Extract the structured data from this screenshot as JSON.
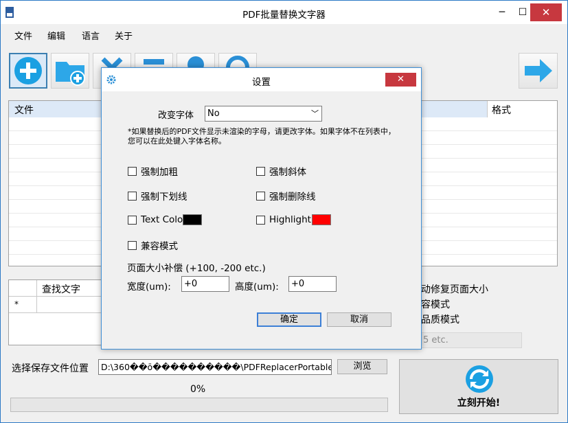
{
  "window": {
    "title": "PDF批量替换文字器",
    "minimize": "─",
    "maximize": "☐",
    "close": "✕"
  },
  "menu": [
    "文件",
    "编辑",
    "语言",
    "关于"
  ],
  "toolbar": {
    "buttons": [
      "add-file-icon",
      "add-folder-icon",
      "delete-icon",
      "clear-icon",
      "settings-icon",
      "help-icon"
    ],
    "next_icon": "arrow-right-icon"
  },
  "file_grid": {
    "col_file": "文件",
    "col_format": "格式"
  },
  "find_grid": {
    "col_find": "查找文字",
    "new_row_marker": "*"
  },
  "background_options": {
    "opt1": "动修复页面大小",
    "opt2": "容模式",
    "opt3": "品质模式",
    "input_partial": "5 etc."
  },
  "save": {
    "label": "选择保存文件位置",
    "path": "D:\\360��ō����������\\PDFReplacerPortable\\P",
    "browse": "浏览"
  },
  "progress": {
    "text": "0%",
    "value": 0
  },
  "start": {
    "label": "立刻开始!"
  },
  "colors": {
    "text_color": "#000000",
    "highlight": "#ff0000",
    "accent": "#3c7fd6"
  },
  "dialog": {
    "title": "设置",
    "close": "✕",
    "font_label": "改变字体",
    "font_value": "No",
    "note": "*如果替换后的PDF文件显示未渲染的字母，请更改字体。如果字体不在列表中，您可以在此处键入字体名称。",
    "checkboxes": {
      "bold": "强制加粗",
      "italic": "强制斜体",
      "underline": "强制下划线",
      "strike": "强制删除线",
      "text_color": "Text Colo",
      "highlight": "Highlight",
      "compat": "兼容模式"
    },
    "page_size_label": "页面大小补偿 (+100, -200 etc.)",
    "width_label": "宽度(um):",
    "width_value": "+0",
    "height_label": "高度(um):",
    "height_value": "+0",
    "ok": "确定",
    "cancel": "取消"
  }
}
